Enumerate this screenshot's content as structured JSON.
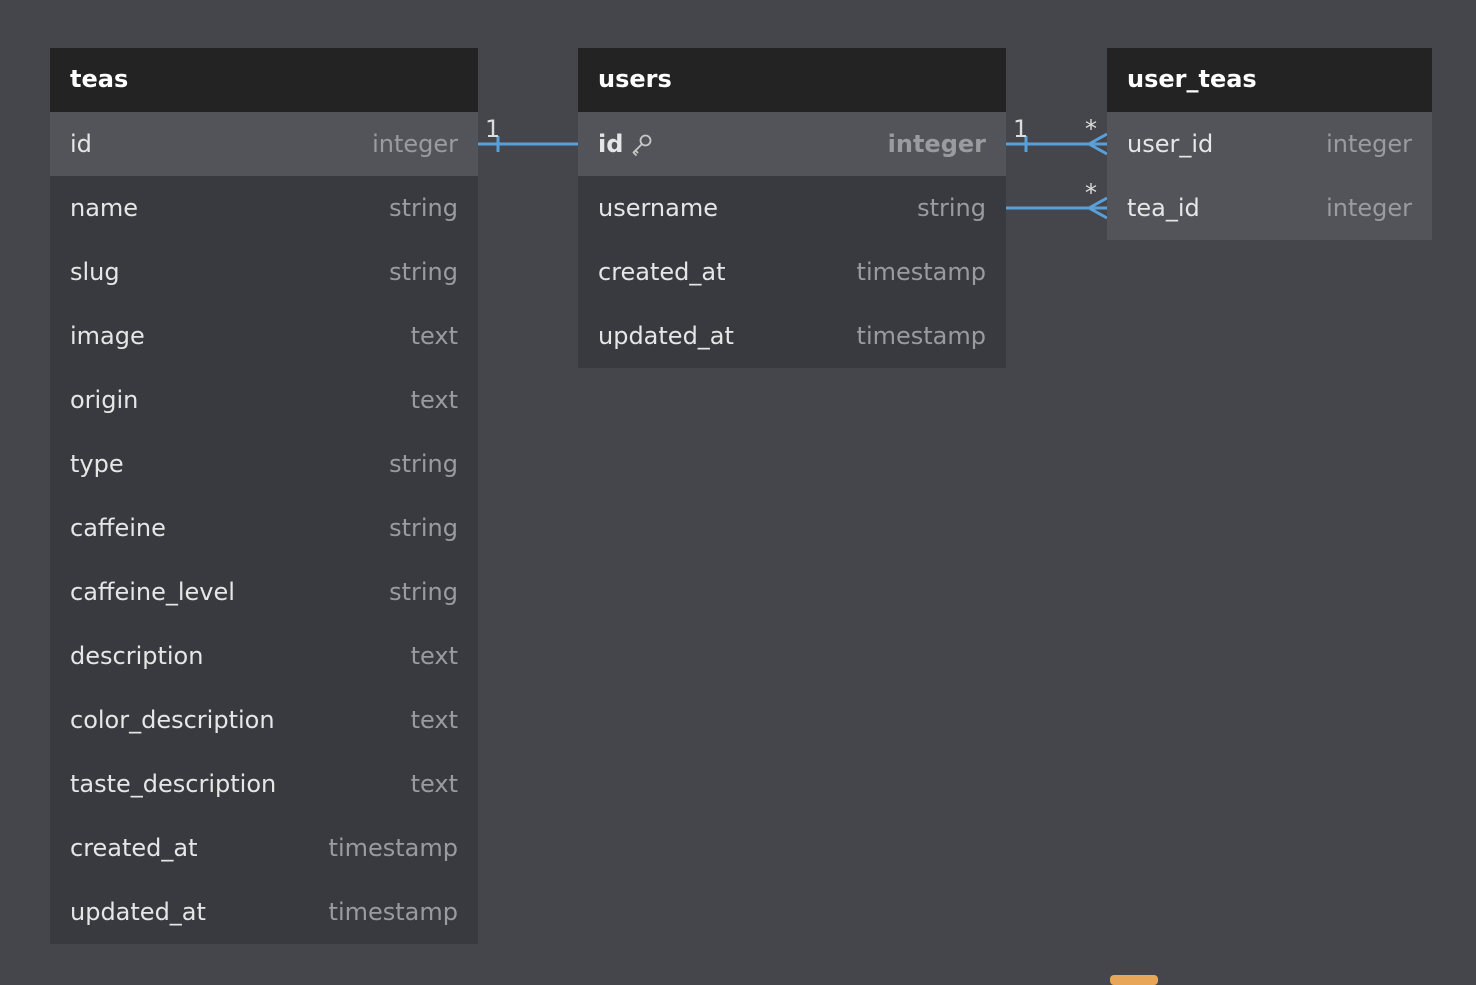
{
  "colors": {
    "canvas": "#45464b",
    "table_body": "#393a3f",
    "table_header": "#232323",
    "highlight_row": "#53545a",
    "connector": "#5aa0d8",
    "badge": "#e8a758"
  },
  "tables": {
    "teas": {
      "name": "teas",
      "fields": [
        {
          "name": "id",
          "type": "integer"
        },
        {
          "name": "name",
          "type": "string"
        },
        {
          "name": "slug",
          "type": "string"
        },
        {
          "name": "image",
          "type": "text"
        },
        {
          "name": "origin",
          "type": "text"
        },
        {
          "name": "type",
          "type": "string"
        },
        {
          "name": "caffeine",
          "type": "string"
        },
        {
          "name": "caffeine_level",
          "type": "string"
        },
        {
          "name": "description",
          "type": "text"
        },
        {
          "name": "color_description",
          "type": "text"
        },
        {
          "name": "taste_description",
          "type": "text"
        },
        {
          "name": "created_at",
          "type": "timestamp"
        },
        {
          "name": "updated_at",
          "type": "timestamp"
        }
      ]
    },
    "users": {
      "name": "users",
      "fields": [
        {
          "name": "id",
          "type": "integer",
          "icon": "key-icon"
        },
        {
          "name": "username",
          "type": "string"
        },
        {
          "name": "created_at",
          "type": "timestamp"
        },
        {
          "name": "updated_at",
          "type": "timestamp"
        }
      ]
    },
    "user_teas": {
      "name": "user_teas",
      "fields": [
        {
          "name": "user_id",
          "type": "integer"
        },
        {
          "name": "tea_id",
          "type": "integer"
        }
      ]
    }
  },
  "relations": [
    {
      "from": "teas.id",
      "to": "users.id",
      "from_label": "1",
      "to_label": ""
    },
    {
      "from": "users.id",
      "to": "user_teas.user_id",
      "from_label": "1",
      "to_label": "*"
    },
    {
      "from": "users.username",
      "to": "user_teas.tea_id",
      "from_label": "",
      "to_label": "*"
    }
  ]
}
